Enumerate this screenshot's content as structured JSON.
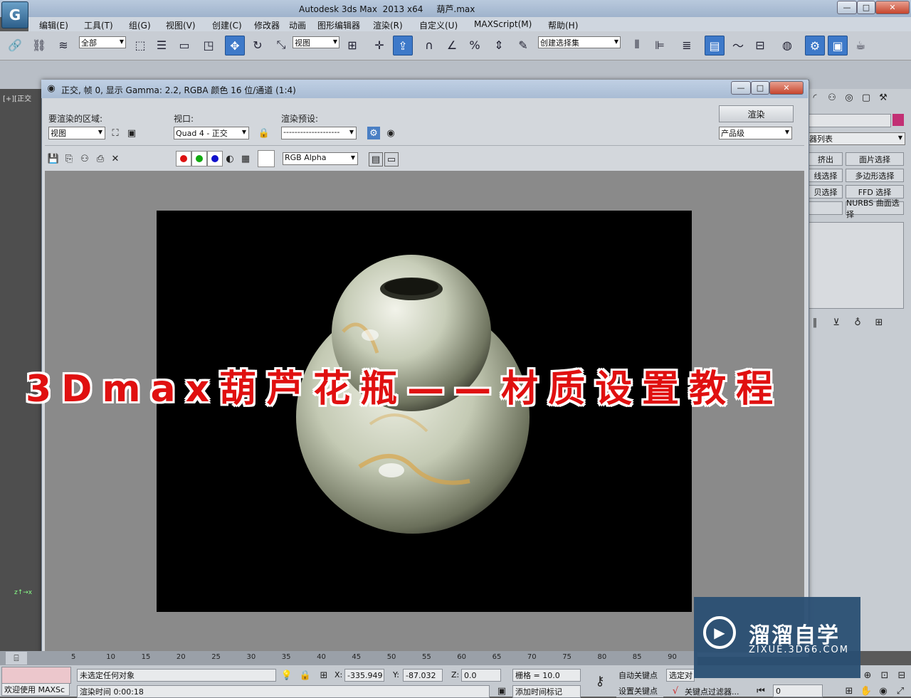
{
  "app": {
    "title": "Autodesk 3ds Max  2013 x64     葫芦.max",
    "logo": "G",
    "window_buttons": [
      "—",
      "□",
      "✕"
    ]
  },
  "menu": [
    "编辑(E)",
    "工具(T)",
    "组(G)",
    "视图(V)",
    "创建(C)",
    "修改器",
    "动画",
    "图形编辑器",
    "渲染(R)",
    "自定义(U)",
    "MAXScript(M)",
    "帮助(H)"
  ],
  "toolbar": {
    "selection_filter": "全部",
    "reference_coord": "视图",
    "named_selection": "创建选择集"
  },
  "viewport_label": "[+][正交",
  "render_window": {
    "title": "正交, 帧 0, 显示 Gamma: 2.2, RGBA 颜色 16 位/通道 (1:4)",
    "area_label": "要渲染的区域:",
    "area_value": "视图",
    "viewport_label": "视口:",
    "viewport_value": "Quad 4 - 正交",
    "preset_label": "渲染预设:",
    "preset_value": "--------------------",
    "render_button": "渲染",
    "quality_value": "产品级",
    "channel_value": "RGB Alpha"
  },
  "overlay_title": "3Dmax葫芦花瓶——材质设置教程",
  "right_panel": {
    "list_label": "器列表",
    "buttons": [
      "挤出",
      "面片选择",
      "线选择",
      "多边形选择",
      "贝选择",
      "FFD 选择",
      "",
      "NURBS 曲面选择"
    ]
  },
  "status": {
    "welcome": "欢迎使用 MAXSc",
    "selection": "未选定任何对象",
    "render_time": "渲染时间  0:00:18",
    "x_label": "X:",
    "x_value": "-335.949",
    "y_label": "Y:",
    "y_value": "-87.032",
    "z_label": "Z:",
    "z_value": "0.0",
    "grid": "栅格 = 10.0",
    "add_time_tag": "添加时间标记",
    "auto_key": "自动关键点",
    "set_key": "设置关键点",
    "selected": "选定对",
    "key_filter": "关键点过滤器...",
    "frame": "0"
  },
  "timeline_ticks": [
    "5",
    "10",
    "15",
    "20",
    "25",
    "30",
    "35",
    "40",
    "45",
    "50",
    "55",
    "60",
    "65",
    "70",
    "75",
    "80",
    "85",
    "90"
  ],
  "watermark": {
    "main": "溜溜自学",
    "sub": "ZIXUE.3D66.COM"
  }
}
